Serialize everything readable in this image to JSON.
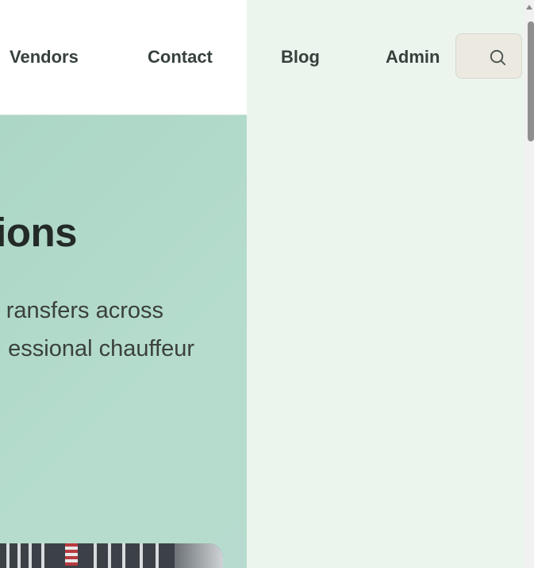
{
  "nav": {
    "items": [
      {
        "label": "Vendors"
      },
      {
        "label": "Contact"
      },
      {
        "label": "Blog"
      },
      {
        "label": "Admin"
      }
    ],
    "search_icon": "search-icon"
  },
  "hero": {
    "title_fragment": "ions",
    "text_line_1": "ransfers across",
    "text_line_2": "essional chauffeur"
  },
  "colors": {
    "header_bg": "#ffffff",
    "hero_bg": "#b0d9c8",
    "page_bg": "#ecf5ed",
    "search_bg": "#ebe9e0",
    "text_dark": "#232a27"
  }
}
